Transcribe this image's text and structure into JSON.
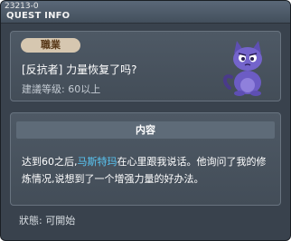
{
  "window": {
    "quest_id": "23213-0",
    "title": "QUEST INFO"
  },
  "quest": {
    "job_badge": "職業",
    "name": "[反抗者] 力量恢复了吗?",
    "level_requirement": "建議等级: 60以上",
    "avatar_icon": "purple-cat-icon"
  },
  "content": {
    "header": "内容",
    "text_before": "达到60之后,",
    "npc_name": "马斯特玛",
    "text_after": "在心里跟我说话。他询问了我的修炼情况,说想到了一个增强力量的好办法。"
  },
  "status": {
    "text": "狀態: 可開始"
  },
  "colors": {
    "npc_highlight": "#59c7f5",
    "badge_bg": "#d6c7b0",
    "window_bg": "#39424d"
  }
}
